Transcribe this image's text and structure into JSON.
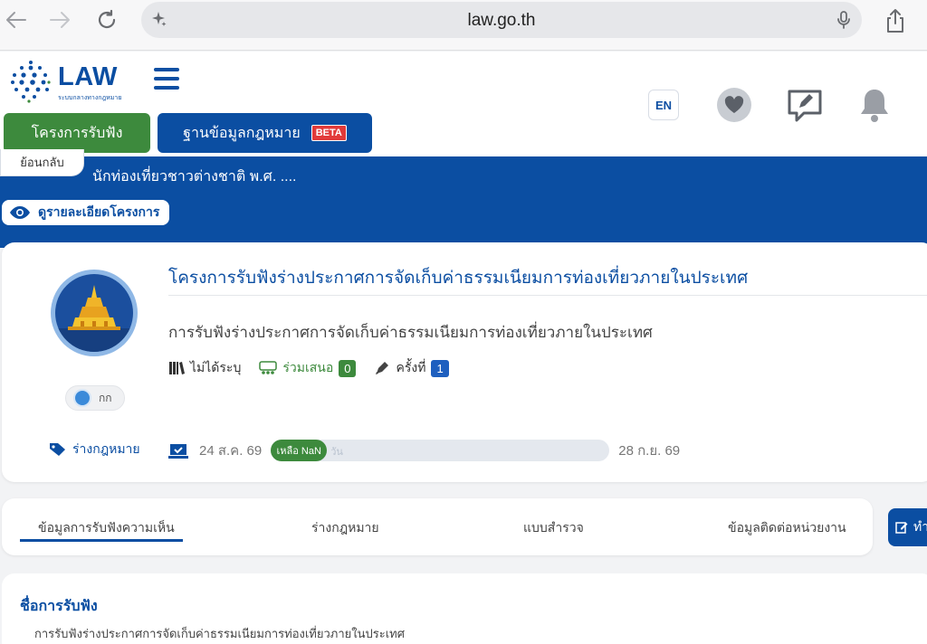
{
  "browser": {
    "url": "law.go.th"
  },
  "header": {
    "logo_word": "LAW",
    "logo_subtitle": "ระบบกลางทางกฎหมาย",
    "nav_tabs": [
      {
        "label": "โครงการรับฟัง"
      },
      {
        "label": "ฐานข้อมูลกฎหมาย",
        "badge": "BETA"
      }
    ],
    "lang_label": "EN"
  },
  "banner": {
    "back_label": "ย้อนกลับ",
    "title": "นักท่องเที่ยวชาวต่างชาติ พ.ศ. ....",
    "details_label": "ดูรายละเอียดโครงการ"
  },
  "project": {
    "title": "โครงการรับฟังร่างประกาศการจัดเก็บค่าธรรมเนียมการท่องเที่ยวภายในประเทศ",
    "description": "การรับฟังร่างประกาศการจัดเก็บค่าธรรมเนียมการท่องเที่ยวภายในประเทศ",
    "agency_label": "กก",
    "draft_tag": "ร่างกฎหมาย",
    "law_type": "ไม่ได้ระบุ",
    "participate_label": "ร่วมเสนอ",
    "participate_count": "0",
    "round_label": "ครั้งที่",
    "round_number": "1",
    "start_date": "24 ส.ค. 69",
    "end_date": "28 ก.ย. 69",
    "remaining_label": "เหลือ NaN",
    "remaining_suffix": "วัน"
  },
  "tabs": [
    {
      "label": "ข้อมูลการรับฟังความเห็น",
      "active": true
    },
    {
      "label": "ร่างกฎหมาย",
      "active": false
    },
    {
      "label": "แบบสำรวจ",
      "active": false
    },
    {
      "label": "ข้อมูลติดต่อหน่วยงาน",
      "active": false
    }
  ],
  "action_button": {
    "label": "ทำ"
  },
  "info": {
    "heading": "ชื่อการรับฟัง",
    "text": "การรับฟังร่างประกาศการจัดเก็บค่าธรรมเนียมการท่องเที่ยวภายในประเทศ"
  },
  "colors": {
    "primary_blue": "#0b4ea2",
    "green": "#3d8a3d",
    "badge_blue": "#1e5fbf"
  }
}
